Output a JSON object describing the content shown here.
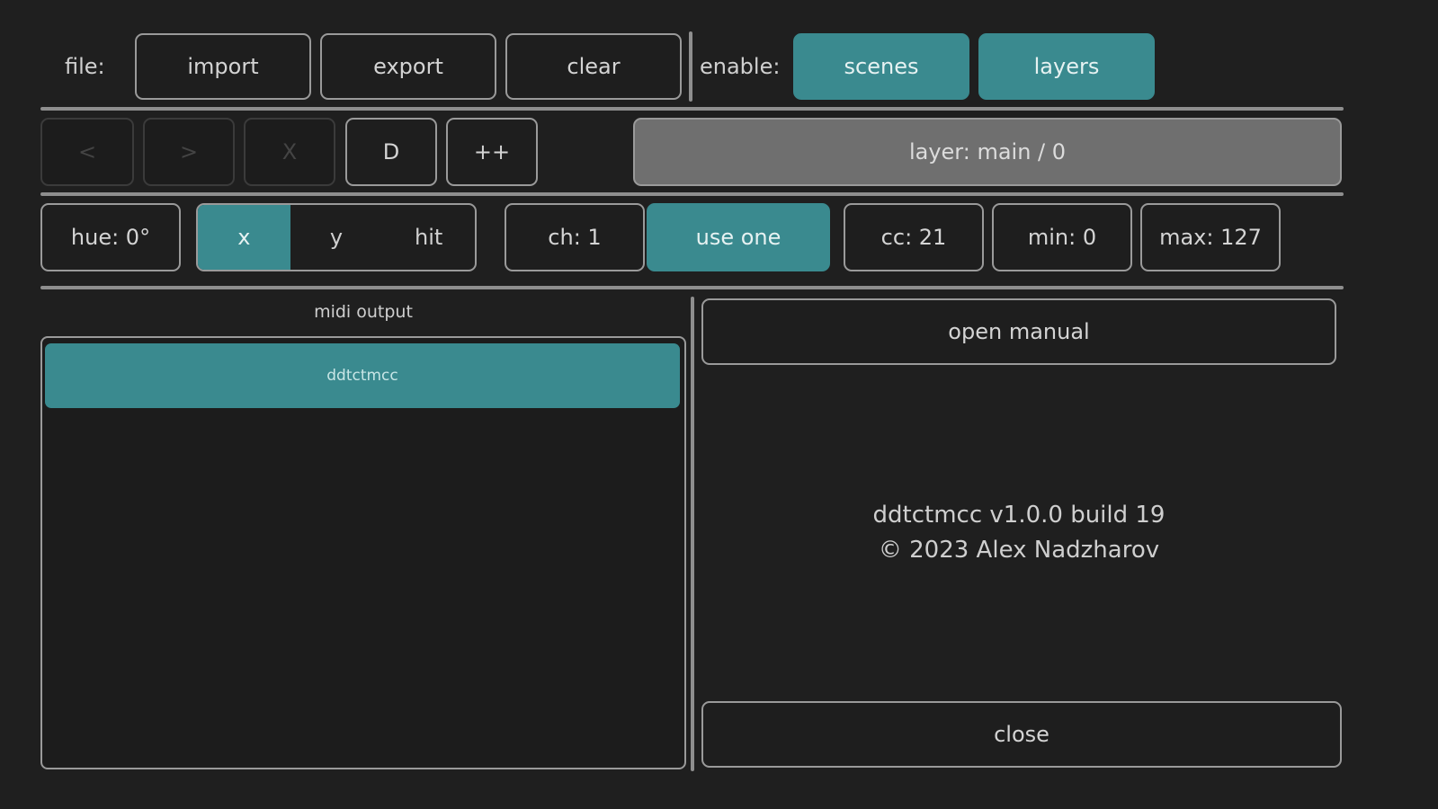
{
  "toolbar": {
    "file_label": "file:",
    "import_label": "import",
    "export_label": "export",
    "clear_label": "clear",
    "enable_label": "enable:",
    "scenes_label": "scenes",
    "layers_label": "layers"
  },
  "nav": {
    "prev_label": "<",
    "next_label": ">",
    "delete_label": "X",
    "duplicate_label": "D",
    "add_label": "++",
    "layer_label": "layer: main / 0"
  },
  "control": {
    "hue_label": "hue: 0°",
    "axis_options": [
      "x",
      "y",
      "hit"
    ],
    "axis_selected": "x",
    "channel_label": "ch: 1",
    "use_one_label": "use one",
    "cc_label": "cc: 21",
    "min_label": "min: 0",
    "max_label": "max: 127"
  },
  "midi": {
    "heading": "midi output",
    "devices": [
      "ddtctmcc"
    ]
  },
  "side": {
    "open_manual_label": "open manual",
    "about_line1": "ddtctmcc v1.0.0 build 19",
    "about_line2": "© 2023 Alex Nadzharov",
    "close_label": "close"
  },
  "colors": {
    "background": "#1f1f1f",
    "accent": "#3a8a8f",
    "border": "#9a9a9a",
    "layer_bar": "#6f6f6f"
  }
}
